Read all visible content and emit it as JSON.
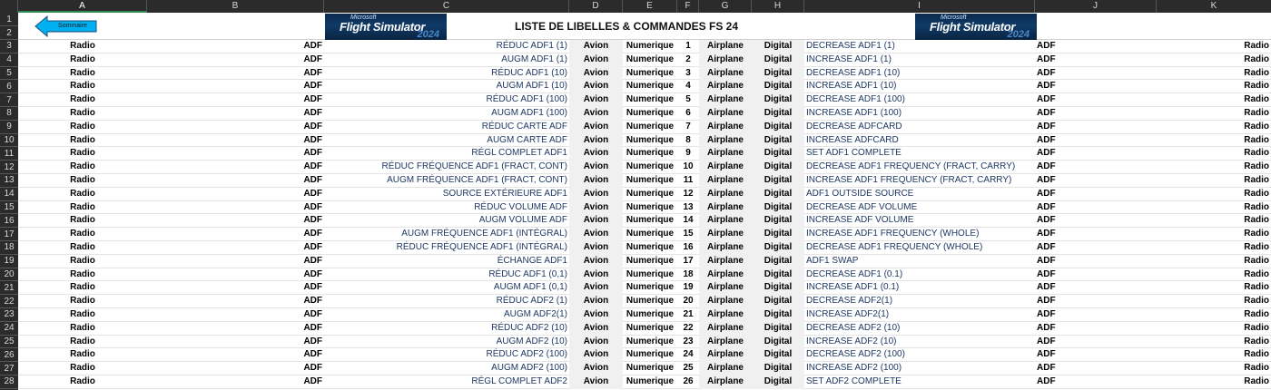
{
  "columns": [
    "A",
    "B",
    "C",
    "D",
    "E",
    "F",
    "G",
    "H",
    "I",
    "J",
    "K"
  ],
  "selected_column": "A",
  "row_numbers": [
    "1",
    "2",
    "3",
    "4",
    "5",
    "6",
    "7",
    "8",
    "9",
    "10",
    "11",
    "12",
    "13",
    "14",
    "15",
    "16",
    "17",
    "18",
    "19",
    "20",
    "21",
    "22",
    "23",
    "24",
    "25",
    "26",
    "27",
    "28"
  ],
  "back_button": {
    "label": "Sommaire"
  },
  "title": "LISTE DE LIBELLES & COMMANDES FS 24",
  "logo": {
    "brand": "Microsoft",
    "name": "Flight Simulator",
    "year": "2024"
  },
  "colors": {
    "header_bg": "#2b2b2b",
    "button_fill": "#00b0f0",
    "logo_bg": "#0f3a66"
  },
  "rows": [
    {
      "a": "Radio",
      "b": "ADF",
      "c": "RÉDUC ADF1 (1)",
      "d": "Avion",
      "e": "Numerique",
      "f": "1",
      "g": "Airplane",
      "h": "Digital",
      "i": "DECREASE ADF1 (1)",
      "j": "ADF",
      "k": "Radio"
    },
    {
      "a": "Radio",
      "b": "ADF",
      "c": "AUGM ADF1 (1)",
      "d": "Avion",
      "e": "Numerique",
      "f": "2",
      "g": "Airplane",
      "h": "Digital",
      "i": "INCREASE ADF1 (1)",
      "j": "ADF",
      "k": "Radio"
    },
    {
      "a": "Radio",
      "b": "ADF",
      "c": "RÉDUC ADF1 (10)",
      "d": "Avion",
      "e": "Numerique",
      "f": "3",
      "g": "Airplane",
      "h": "Digital",
      "i": "DECREASE ADF1 (10)",
      "j": "ADF",
      "k": "Radio"
    },
    {
      "a": "Radio",
      "b": "ADF",
      "c": "AUGM ADF1 (10)",
      "d": "Avion",
      "e": "Numerique",
      "f": "4",
      "g": "Airplane",
      "h": "Digital",
      "i": "INCREASE ADF1 (10)",
      "j": "ADF",
      "k": "Radio"
    },
    {
      "a": "Radio",
      "b": "ADF",
      "c": "RÉDUC ADF1 (100)",
      "d": "Avion",
      "e": "Numerique",
      "f": "5",
      "g": "Airplane",
      "h": "Digital",
      "i": "DECREASE ADF1 (100)",
      "j": "ADF",
      "k": "Radio"
    },
    {
      "a": "Radio",
      "b": "ADF",
      "c": "AUGM ADF1 (100)",
      "d": "Avion",
      "e": "Numerique",
      "f": "6",
      "g": "Airplane",
      "h": "Digital",
      "i": "INCREASE ADF1 (100)",
      "j": "ADF",
      "k": "Radio"
    },
    {
      "a": "Radio",
      "b": "ADF",
      "c": "RÉDUC CARTE ADF",
      "d": "Avion",
      "e": "Numerique",
      "f": "7",
      "g": "Airplane",
      "h": "Digital",
      "i": "DECREASE ADFCARD",
      "j": "ADF",
      "k": "Radio"
    },
    {
      "a": "Radio",
      "b": "ADF",
      "c": "AUGM CARTE ADF",
      "d": "Avion",
      "e": "Numerique",
      "f": "8",
      "g": "Airplane",
      "h": "Digital",
      "i": "INCREASE ADFCARD",
      "j": "ADF",
      "k": "Radio"
    },
    {
      "a": "Radio",
      "b": "ADF",
      "c": "RÉGL COMPLET ADF1",
      "d": "Avion",
      "e": "Numerique",
      "f": "9",
      "g": "Airplane",
      "h": "Digital",
      "i": "SET ADF1 COMPLETE",
      "j": "ADF",
      "k": "Radio"
    },
    {
      "a": "Radio",
      "b": "ADF",
      "c": "RÉDUC FRÉQUENCE ADF1 (FRACT, CONT)",
      "d": "Avion",
      "e": "Numerique",
      "f": "10",
      "g": "Airplane",
      "h": "Digital",
      "i": "DECREASE ADF1 FREQUENCY (FRACT, CARRY)",
      "j": "ADF",
      "k": "Radio"
    },
    {
      "a": "Radio",
      "b": "ADF",
      "c": "AUGM FRÉQUENCE ADF1 (FRACT, CONT)",
      "d": "Avion",
      "e": "Numerique",
      "f": "11",
      "g": "Airplane",
      "h": "Digital",
      "i": "INCREASE ADF1 FREQUENCY (FRACT, CARRY)",
      "j": "ADF",
      "k": "Radio"
    },
    {
      "a": "Radio",
      "b": "ADF",
      "c": "SOURCE EXTÉRIEURE ADF1",
      "d": "Avion",
      "e": "Numerique",
      "f": "12",
      "g": "Airplane",
      "h": "Digital",
      "i": "ADF1 OUTSIDE SOURCE",
      "j": "ADF",
      "k": "Radio"
    },
    {
      "a": "Radio",
      "b": "ADF",
      "c": "RÉDUC VOLUME ADF",
      "d": "Avion",
      "e": "Numerique",
      "f": "13",
      "g": "Airplane",
      "h": "Digital",
      "i": "DECREASE ADF VOLUME",
      "j": "ADF",
      "k": "Radio"
    },
    {
      "a": "Radio",
      "b": "ADF",
      "c": "AUGM VOLUME ADF",
      "d": "Avion",
      "e": "Numerique",
      "f": "14",
      "g": "Airplane",
      "h": "Digital",
      "i": "INCREASE ADF VOLUME",
      "j": "ADF",
      "k": "Radio"
    },
    {
      "a": "Radio",
      "b": "ADF",
      "c": "AUGM FRÉQUENCE ADF1 (INTÉGRAL)",
      "d": "Avion",
      "e": "Numerique",
      "f": "15",
      "g": "Airplane",
      "h": "Digital",
      "i": "INCREASE ADF1 FREQUENCY (WHOLE)",
      "j": "ADF",
      "k": "Radio"
    },
    {
      "a": "Radio",
      "b": "ADF",
      "c": "RÉDUC FRÉQUENCE ADF1 (INTÉGRAL)",
      "d": "Avion",
      "e": "Numerique",
      "f": "16",
      "g": "Airplane",
      "h": "Digital",
      "i": "DECREASE ADF1 FREQUENCY (WHOLE)",
      "j": "ADF",
      "k": "Radio"
    },
    {
      "a": "Radio",
      "b": "ADF",
      "c": "ÉCHANGE ADF1",
      "d": "Avion",
      "e": "Numerique",
      "f": "17",
      "g": "Airplane",
      "h": "Digital",
      "i": "ADF1 SWAP",
      "j": "ADF",
      "k": "Radio"
    },
    {
      "a": "Radio",
      "b": "ADF",
      "c": "RÉDUC ADF1 (0,1)",
      "d": "Avion",
      "e": "Numerique",
      "f": "18",
      "g": "Airplane",
      "h": "Digital",
      "i": "DECREASE ADF1 (0.1)",
      "j": "ADF",
      "k": "Radio"
    },
    {
      "a": "Radio",
      "b": "ADF",
      "c": "AUGM ADF1 (0,1)",
      "d": "Avion",
      "e": "Numerique",
      "f": "19",
      "g": "Airplane",
      "h": "Digital",
      "i": "INCREASE ADF1 (0.1)",
      "j": "ADF",
      "k": "Radio"
    },
    {
      "a": "Radio",
      "b": "ADF",
      "c": "RÉDUC ADF2 (1)",
      "d": "Avion",
      "e": "Numerique",
      "f": "20",
      "g": "Airplane",
      "h": "Digital",
      "i": "DECREASE ADF2(1)",
      "j": "ADF",
      "k": "Radio"
    },
    {
      "a": "Radio",
      "b": "ADF",
      "c": "AUGM ADF2(1)",
      "d": "Avion",
      "e": "Numerique",
      "f": "21",
      "g": "Airplane",
      "h": "Digital",
      "i": "INCREASE ADF2(1)",
      "j": "ADF",
      "k": "Radio"
    },
    {
      "a": "Radio",
      "b": "ADF",
      "c": "RÉDUC ADF2 (10)",
      "d": "Avion",
      "e": "Numerique",
      "f": "22",
      "g": "Airplane",
      "h": "Digital",
      "i": "DECREASE ADF2 (10)",
      "j": "ADF",
      "k": "Radio"
    },
    {
      "a": "Radio",
      "b": "ADF",
      "c": "AUGM ADF2 (10)",
      "d": "Avion",
      "e": "Numerique",
      "f": "23",
      "g": "Airplane",
      "h": "Digital",
      "i": "INCREASE ADF2 (10)",
      "j": "ADF",
      "k": "Radio"
    },
    {
      "a": "Radio",
      "b": "ADF",
      "c": "RÉDUC ADF2 (100)",
      "d": "Avion",
      "e": "Numerique",
      "f": "24",
      "g": "Airplane",
      "h": "Digital",
      "i": "DECREASE ADF2 (100)",
      "j": "ADF",
      "k": "Radio"
    },
    {
      "a": "Radio",
      "b": "ADF",
      "c": "AUGM ADF2 (100)",
      "d": "Avion",
      "e": "Numerique",
      "f": "25",
      "g": "Airplane",
      "h": "Digital",
      "i": "INCREASE ADF2 (100)",
      "j": "ADF",
      "k": "Radio"
    },
    {
      "a": "Radio",
      "b": "ADF",
      "c": "RÉGL COMPLET ADF2",
      "d": "Avion",
      "e": "Numerique",
      "f": "26",
      "g": "Airplane",
      "h": "Digital",
      "i": "SET ADF2 COMPLETE",
      "j": "ADF",
      "k": "Radio"
    }
  ]
}
